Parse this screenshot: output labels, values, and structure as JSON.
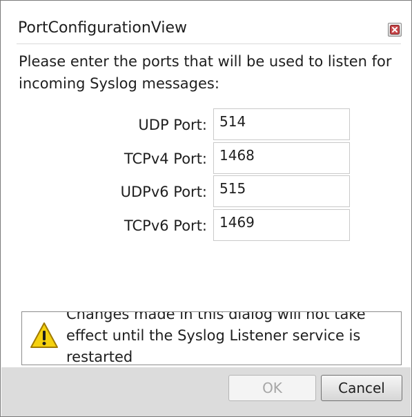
{
  "window": {
    "title": "PortConfigurationView",
    "close_icon": "close-icon"
  },
  "instructions": "Please enter the ports that will be used to listen for incoming Syslog messages:",
  "ports": [
    {
      "label": "UDP Port:",
      "value": "514"
    },
    {
      "label": "TCPv4 Port:",
      "value": "1468"
    },
    {
      "label": "UDPv6 Port:",
      "value": "515"
    },
    {
      "label": "TCPv6 Port:",
      "value": "1469"
    }
  ],
  "notice": {
    "icon": "warning-icon",
    "text": "Changes made in this dialog will not take effect until the Syslog Listener service is restarted"
  },
  "buttons": {
    "ok_label": "OK",
    "ok_enabled": false,
    "cancel_label": "Cancel"
  },
  "colors": {
    "warning_fill": "#f5d10e",
    "close_glyph": "#b3262a",
    "button_bar": "#dcdcdc"
  }
}
